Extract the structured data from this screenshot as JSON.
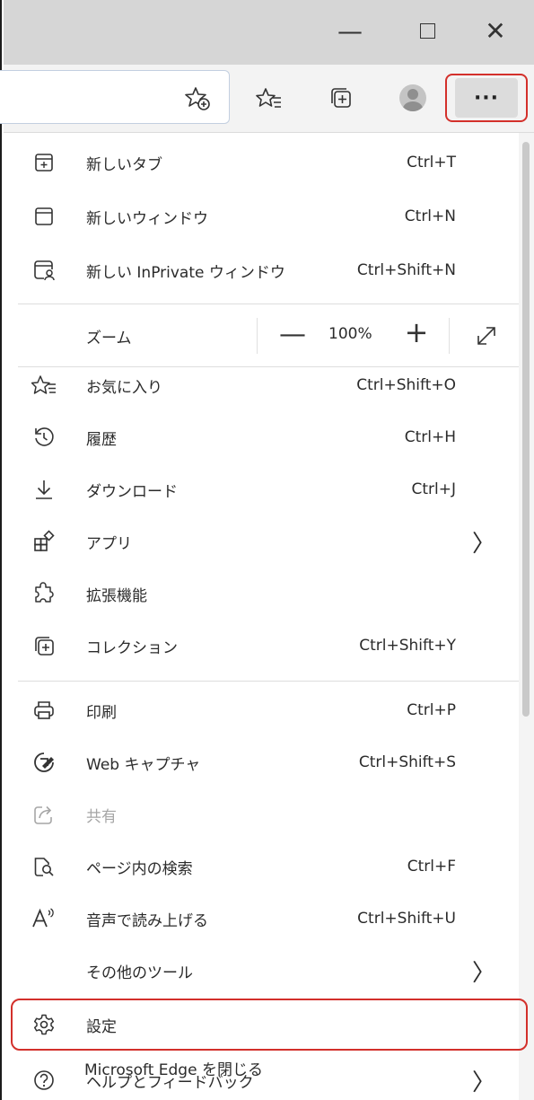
{
  "window": {
    "minimize_glyph": "—",
    "close_glyph": "✕"
  },
  "toolbar": {
    "more_label": "···"
  },
  "menu": {
    "items_top": [
      {
        "label": "新しいタブ",
        "shortcut": "Ctrl+T",
        "icon": "new-tab-icon"
      },
      {
        "label": "新しいウィンドウ",
        "shortcut": "Ctrl+N",
        "icon": "new-window-icon"
      },
      {
        "label": "新しい InPrivate ウィンドウ",
        "shortcut": "Ctrl+Shift+N",
        "icon": "inprivate-icon"
      }
    ],
    "zoom": {
      "label": "ズーム",
      "value": "100%",
      "minus": "—",
      "plus": "+"
    },
    "items_mid": [
      {
        "label": "お気に入り",
        "shortcut": "Ctrl+Shift+O",
        "icon": "favorites-icon"
      },
      {
        "label": "履歴",
        "shortcut": "Ctrl+H",
        "icon": "history-icon"
      },
      {
        "label": "ダウンロード",
        "shortcut": "Ctrl+J",
        "icon": "download-icon"
      },
      {
        "label": "アプリ",
        "shortcut": "",
        "icon": "apps-icon",
        "submenu": true
      },
      {
        "label": "拡張機能",
        "shortcut": "",
        "icon": "extensions-icon"
      },
      {
        "label": "コレクション",
        "shortcut": "Ctrl+Shift+Y",
        "icon": "collections-icon"
      }
    ],
    "items_tools": [
      {
        "label": "印刷",
        "shortcut": "Ctrl+P",
        "icon": "print-icon"
      },
      {
        "label": "Web キャプチャ",
        "shortcut": "Ctrl+Shift+S",
        "icon": "web-capture-icon"
      },
      {
        "label": "共有",
        "shortcut": "",
        "icon": "share-icon",
        "disabled": true
      },
      {
        "label": "ページ内の検索",
        "shortcut": "Ctrl+F",
        "icon": "find-icon"
      },
      {
        "label": "音声で読み上げる",
        "shortcut": "Ctrl+Shift+U",
        "icon": "read-aloud-icon"
      },
      {
        "label": "その他のツール",
        "shortcut": "",
        "icon": "",
        "submenu": true
      }
    ],
    "settings": {
      "label": "設定",
      "icon": "settings-icon"
    },
    "help": {
      "label": "ヘルプとフィードバック",
      "icon": "help-icon",
      "submenu": true
    },
    "close": {
      "label": "Microsoft Edge を閉じる"
    },
    "submenu_glyph": "〉"
  },
  "colors": {
    "highlight": "#d3302b",
    "titlebar": "#d6d6d6",
    "toolbar": "#f3f3f3"
  }
}
